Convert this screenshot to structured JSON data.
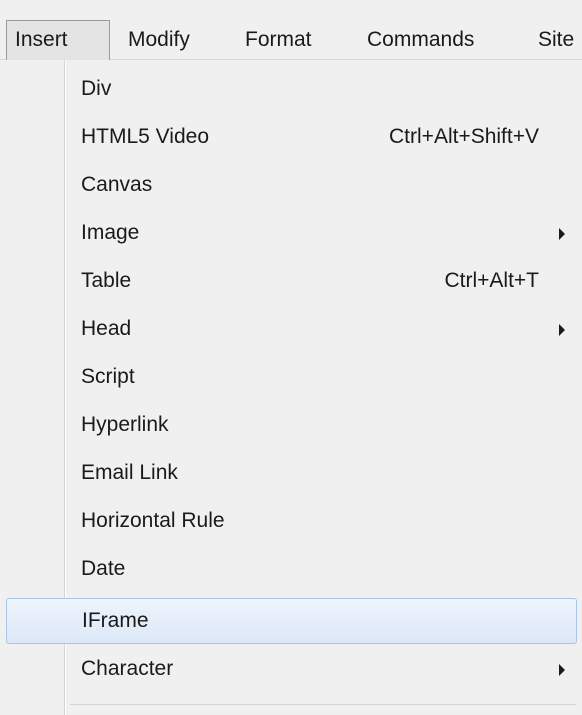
{
  "menubar": {
    "items": [
      {
        "label": "Insert"
      },
      {
        "label": "Modify"
      },
      {
        "label": "Format"
      },
      {
        "label": "Commands"
      },
      {
        "label": "Site"
      }
    ],
    "active_item": "Insert"
  },
  "insert_menu": {
    "items": [
      {
        "label": "Div",
        "shortcut": ""
      },
      {
        "label": "HTML5 Video",
        "shortcut": "Ctrl+Alt+Shift+V"
      },
      {
        "label": "Canvas",
        "shortcut": ""
      },
      {
        "label": "Image",
        "shortcut": "",
        "has_submenu": true
      },
      {
        "label": "Table",
        "shortcut": "Ctrl+Alt+T"
      },
      {
        "label": "Head",
        "shortcut": "",
        "has_submenu": true
      },
      {
        "label": "Script",
        "shortcut": ""
      },
      {
        "label": "Hyperlink",
        "shortcut": ""
      },
      {
        "label": "Email Link",
        "shortcut": ""
      },
      {
        "label": "Horizontal Rule",
        "shortcut": ""
      },
      {
        "label": "Date",
        "shortcut": ""
      },
      {
        "label": "IFrame",
        "shortcut": "",
        "highlighted": true
      },
      {
        "label": "Character",
        "shortcut": "",
        "has_submenu": true
      }
    ]
  },
  "colors": {
    "menu_background": "#f0f0f0",
    "highlight_background": "#dce8f8",
    "highlight_border": "#a9c5ea",
    "text": "#1a1a1a"
  },
  "icons": {
    "submenu": "submenu-arrow-icon"
  }
}
